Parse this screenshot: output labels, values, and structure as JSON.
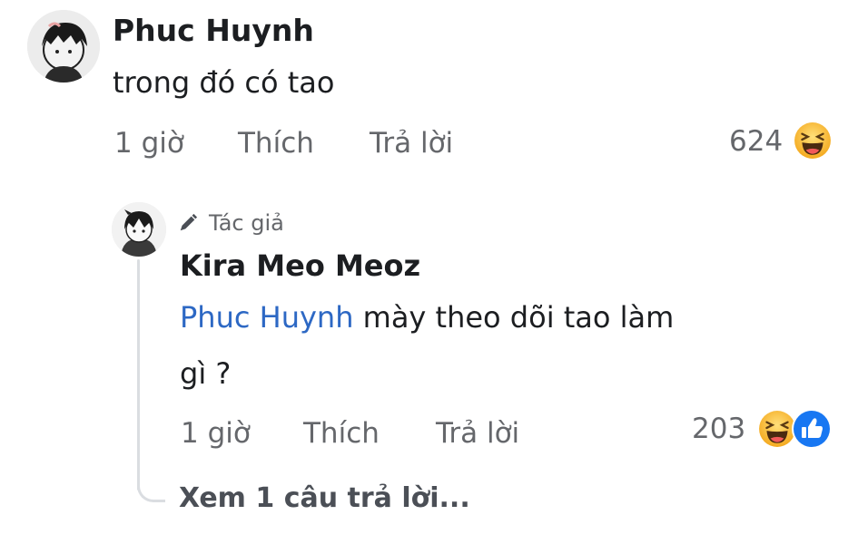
{
  "comment": {
    "author": "Phuc Huynh",
    "text": "trong đó có tao",
    "time": "1 giờ",
    "like_label": "Thích",
    "reply_label": "Trả lời",
    "reaction_count": "624",
    "reaction_icons": [
      "haha-emoji"
    ]
  },
  "reply": {
    "badge_label": "Tác giả",
    "author": "Kira Meo Meoz",
    "mention": "Phuc Huynh",
    "text_line1": " mày theo dõi tao làm",
    "text_line2": "gì ?",
    "time": "1 giờ",
    "like_label": "Thích",
    "reply_label": "Trả lời",
    "reaction_count": "203",
    "reaction_icons": [
      "haha-emoji",
      "like-emoji"
    ]
  },
  "view_more_label": "Xem 1 câu trả lời...",
  "colors": {
    "mention": "#2d68c4",
    "secondary_text": "#65676b",
    "like_blue": "#1877f2",
    "haha_yellow": "#f7b928"
  }
}
